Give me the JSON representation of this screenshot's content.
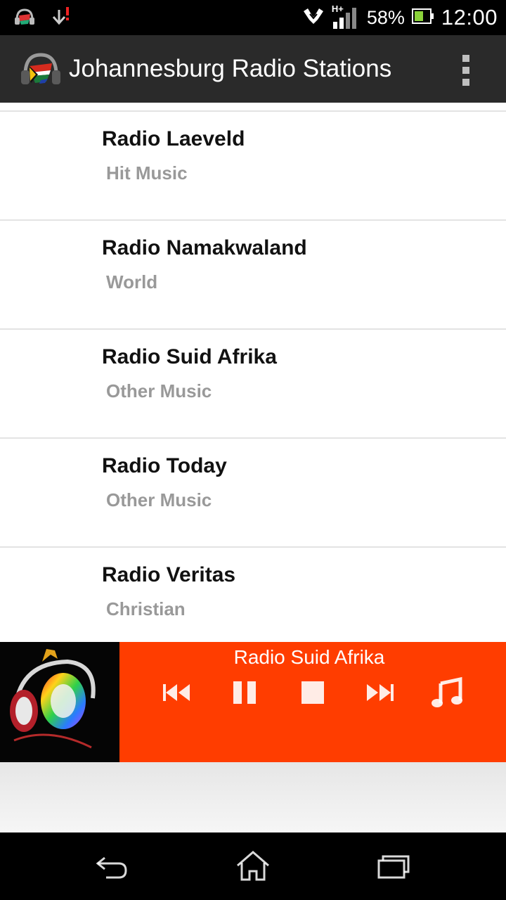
{
  "status_bar": {
    "battery_percent": "58%",
    "time": "12:00",
    "network_label": "H+",
    "icons": [
      "app-notification-icon",
      "download-icon",
      "hands-icon",
      "signal-icon",
      "battery-icon"
    ]
  },
  "header": {
    "title": "Johannesburg Radio Stations",
    "icons": [
      "app-logo-icon",
      "overflow-menu-icon"
    ]
  },
  "stations": [
    {
      "name": "Radio Laeveld",
      "genre": "Hit Music"
    },
    {
      "name": "Radio Namakwaland",
      "genre": "World"
    },
    {
      "name": "Radio Suid Afrika",
      "genre": "Other Music"
    },
    {
      "name": "Radio Today",
      "genre": "Other Music"
    },
    {
      "name": "Radio Veritas",
      "genre": "Christian"
    }
  ],
  "player": {
    "now_playing": "Radio Suid Afrika",
    "controls": [
      "previous-icon",
      "pause-icon",
      "stop-icon",
      "next-icon",
      "music-note-icon"
    ],
    "accent_color": "#ff3d00"
  },
  "nav_bar": {
    "icons": [
      "back-icon",
      "home-icon",
      "recent-apps-icon"
    ]
  }
}
